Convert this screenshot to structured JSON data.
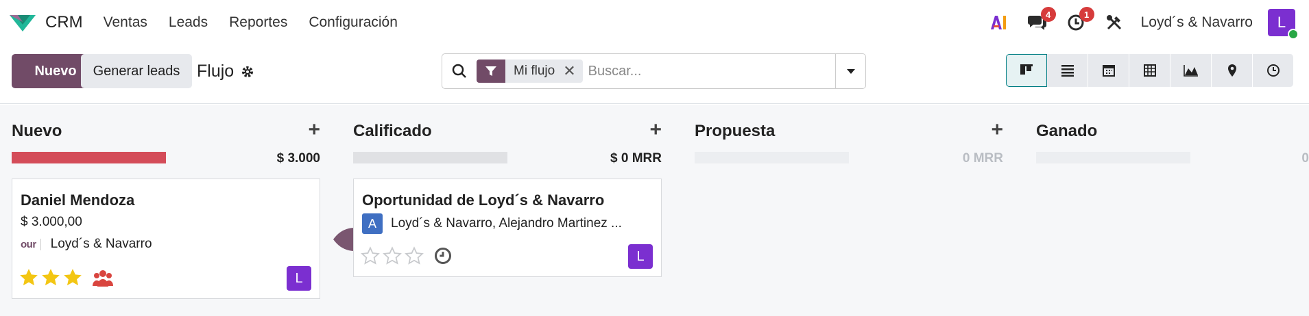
{
  "navbar": {
    "app_name": "CRM",
    "menu": [
      "Ventas",
      "Leads",
      "Reportes",
      "Configuración"
    ],
    "ai_icon": "ai-icon",
    "messages_count": "4",
    "activities_count": "1",
    "company": "Loyd´s & Navarro",
    "user_initial": "L"
  },
  "control": {
    "new_label": "Nuevo",
    "generate_label": "Generar leads",
    "view_title": "Flujo",
    "facet_label": "Mi flujo",
    "search_placeholder": "Buscar...",
    "views": [
      "kanban",
      "list",
      "calendar",
      "pivot",
      "graph",
      "map",
      "activity"
    ],
    "active_view": "kanban"
  },
  "kanban": {
    "columns": [
      {
        "title": "Nuevo",
        "total": "$ 3.000",
        "progress_fraction": 1.0,
        "progress_color": "#d44c59",
        "card": {
          "title": "Daniel Mendoza",
          "amount": "$ 3.000,00",
          "partner_logo_text": "our",
          "partner": "Loyd´s & Navarro",
          "stars": 3,
          "stars_total": 3,
          "salesperson": "L"
        }
      },
      {
        "title": "Calificado",
        "total": "$ 0 MRR",
        "progress_fraction": 0,
        "card": {
          "title": "Oportunidad de Loyd´s & Navarro",
          "partner_avatar": "A",
          "partner": "Loyd´s & Navarro, Alejandro Martinez ...",
          "stars": 0,
          "stars_total": 3,
          "salesperson": "L"
        }
      },
      {
        "title": "Propuesta",
        "total": "0 MRR",
        "progress_fraction": 0
      },
      {
        "title": "Ganado",
        "total": "0",
        "progress_fraction": 0
      }
    ]
  },
  "colors": {
    "brand": "#714b67",
    "accent": "#017e84",
    "badge": "#d63b3b",
    "avatar": "#7b2fd0",
    "star": "#f3c613"
  }
}
